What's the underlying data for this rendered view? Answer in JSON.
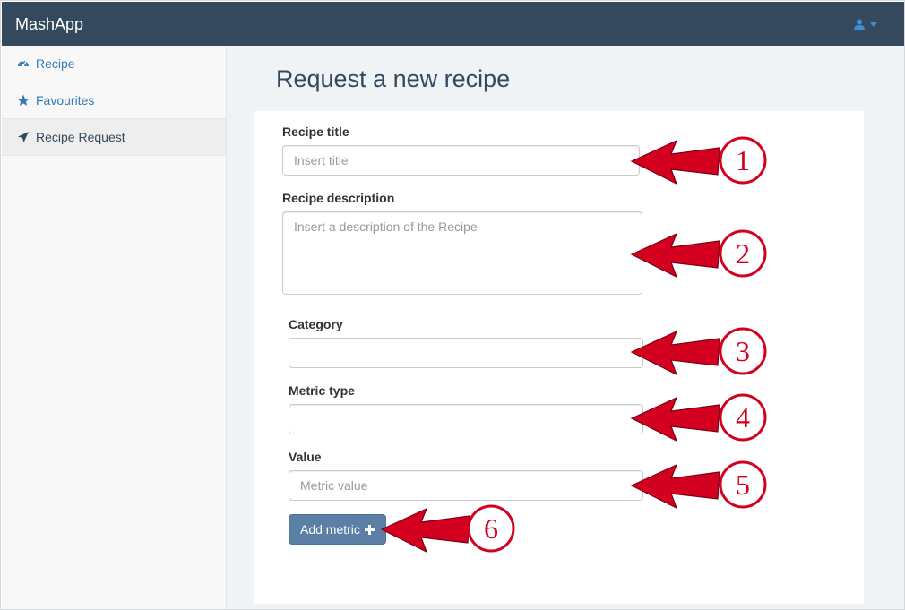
{
  "app": {
    "brand": "MashApp"
  },
  "navbar": {
    "user_icon": "user-icon",
    "caret_icon": "caret-down-icon"
  },
  "sidebar": {
    "items": [
      {
        "label": "Recipe",
        "icon": "dashboard-icon"
      },
      {
        "label": "Favourites",
        "icon": "star-icon"
      },
      {
        "label": "Recipe Request",
        "icon": "send-icon",
        "active": true
      }
    ]
  },
  "page": {
    "title": "Request a new recipe"
  },
  "form": {
    "title_label": "Recipe title",
    "title_placeholder": "Insert title",
    "description_label": "Recipe description",
    "description_placeholder": "Insert a description of the Recipe",
    "category_label": "Category",
    "metric_type_label": "Metric type",
    "value_label": "Value",
    "value_placeholder": "Metric value",
    "add_metric_label": "Add metric"
  },
  "annotations": [
    "1",
    "2",
    "3",
    "4",
    "5",
    "6"
  ],
  "colors": {
    "navbar": "#34495e",
    "link": "#337ab7",
    "button": "#5b7fa5",
    "arrow": "#d4001f"
  }
}
